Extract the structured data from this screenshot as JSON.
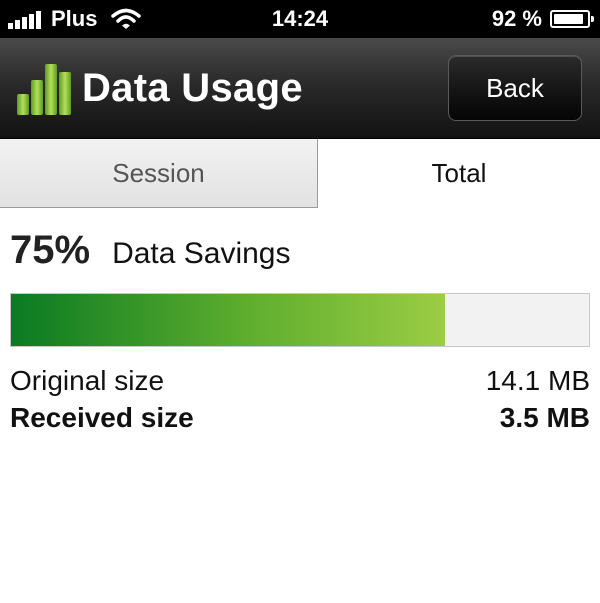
{
  "status_bar": {
    "carrier": "Plus",
    "time": "14:24",
    "battery_percent": "92 %",
    "battery_level": 0.92
  },
  "header": {
    "title": "Data Usage",
    "back_label": "Back",
    "logo_icon": "bar-chart-logo-icon"
  },
  "tabs": [
    {
      "label": "Session",
      "selected": false
    },
    {
      "label": "Total",
      "selected": true
    }
  ],
  "savings": {
    "percent": "75%",
    "label": "Data Savings",
    "fill_fraction": 0.75
  },
  "sizes": {
    "original_label": "Original size",
    "original_value": "14.1 MB",
    "received_label": "Received size",
    "received_value": "3.5 MB"
  },
  "colors": {
    "progress_start": "#0a7a22",
    "progress_end": "#9ccd45",
    "logo_green": "#8cc63f"
  }
}
